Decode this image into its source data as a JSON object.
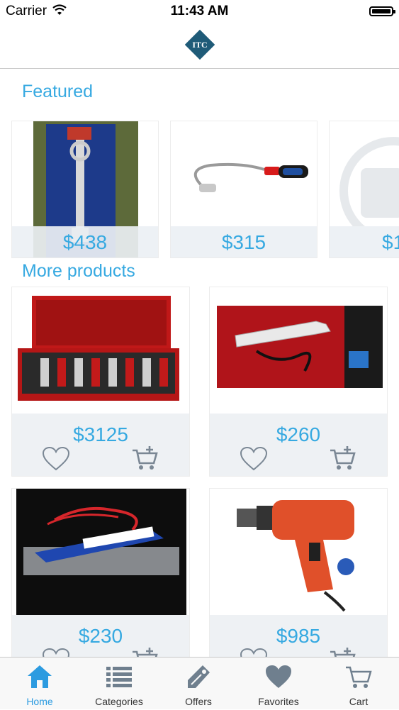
{
  "status_bar": {
    "carrier": "Carrier",
    "time": "11:43 AM"
  },
  "header": {
    "logo_text": "ITC"
  },
  "featured": {
    "title": "Featured",
    "items": [
      {
        "price": "$438",
        "image": "wrench-product"
      },
      {
        "price": "$315",
        "image": "flexible-magnet-pickup-tool"
      },
      {
        "price": "$1",
        "image": "no-image-placeholder"
      }
    ]
  },
  "more_products": {
    "title": "More products",
    "items": [
      {
        "price": "$3125",
        "image": "red-tool-case"
      },
      {
        "price": "$260",
        "image": "circuit-tester"
      },
      {
        "price": "$230",
        "image": "voltage-tester-pen"
      },
      {
        "price": "$985",
        "image": "red-power-drill"
      }
    ]
  },
  "tab_bar": {
    "items": [
      {
        "label": "Home",
        "icon": "home-icon",
        "active": true
      },
      {
        "label": "Categories",
        "icon": "list-icon",
        "active": false
      },
      {
        "label": "Offers",
        "icon": "tag-icon",
        "active": false
      },
      {
        "label": "Favorites",
        "icon": "heart-icon",
        "active": false
      },
      {
        "label": "Cart",
        "icon": "cart-icon",
        "active": false
      }
    ]
  },
  "colors": {
    "accent": "#36a9e1",
    "tab_active": "#2c9be0",
    "tab_inactive": "#6f7f8e",
    "brand_logo": "#1f5b78"
  }
}
